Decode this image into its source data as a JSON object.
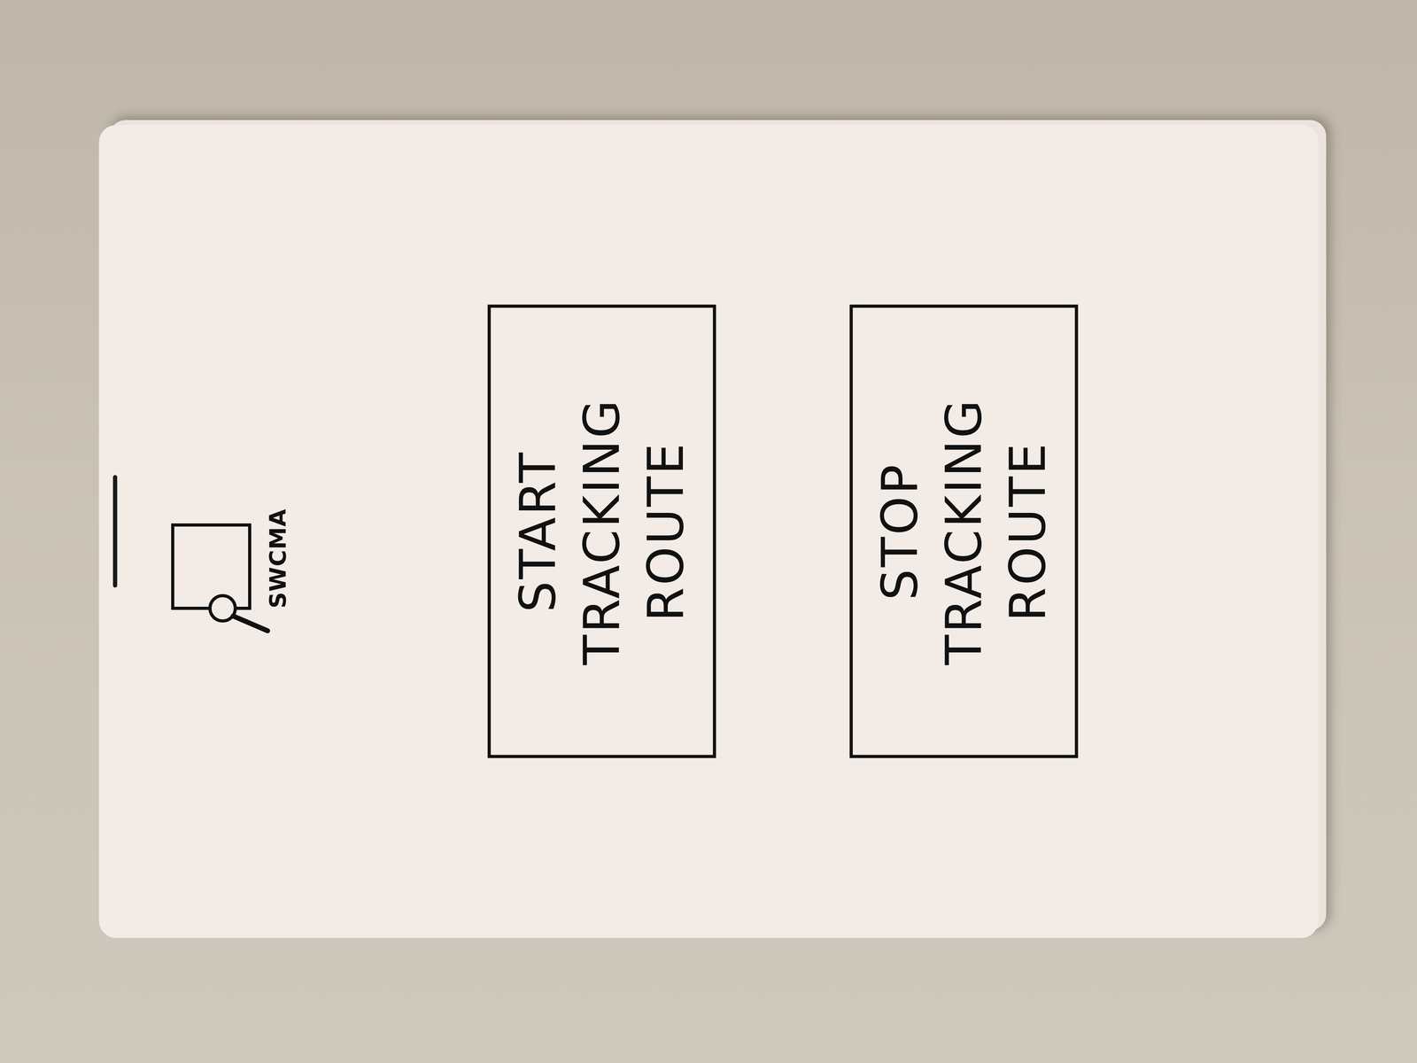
{
  "app": {
    "logo_text": "SWCMA"
  },
  "buttons": [
    {
      "lines": [
        "START",
        "TRACKING",
        "ROUTE"
      ]
    },
    {
      "lines": [
        "STOP",
        "TRACKING",
        "ROUTE"
      ]
    }
  ]
}
